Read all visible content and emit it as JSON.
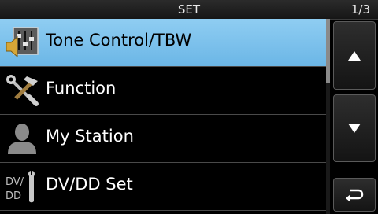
{
  "header": {
    "title": "SET",
    "page_indicator": "1/3"
  },
  "menu": {
    "items": [
      {
        "label": "Tone Control/TBW",
        "icon": "tone-control-icon",
        "selected": true
      },
      {
        "label": "Function",
        "icon": "tools-icon",
        "selected": false
      },
      {
        "label": "My Station",
        "icon": "person-icon",
        "selected": false
      },
      {
        "label": "DV/DD Set",
        "icon": "dv-dd-wrench-icon",
        "selected": false,
        "icon_text": "DV/\nDD"
      }
    ]
  },
  "controls": {
    "up": "up-arrow-icon",
    "down": "down-arrow-icon",
    "back": "return-arrow-icon"
  },
  "colors": {
    "selected_row": "#7cc3ec",
    "background": "#000000"
  },
  "scroll": {
    "position": 0
  }
}
